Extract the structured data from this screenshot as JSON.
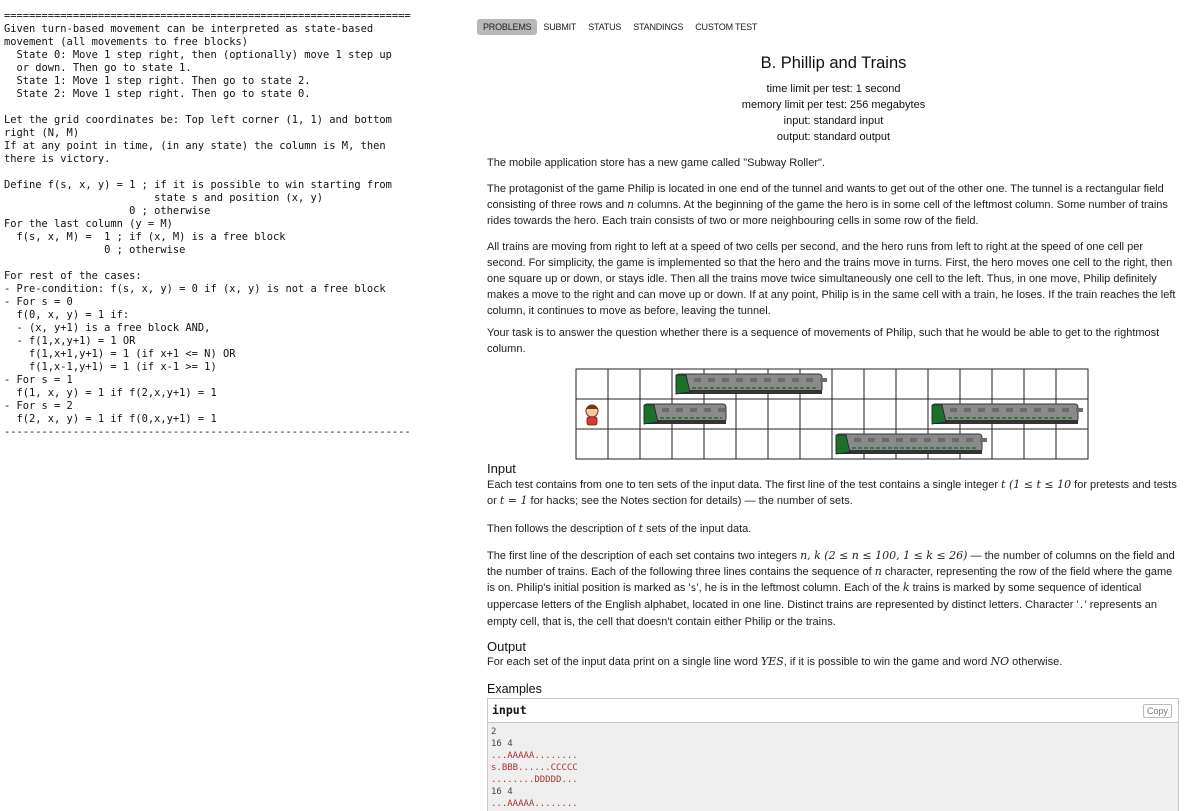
{
  "notes": {
    "text": "=================================================================\nGiven turn-based movement can be interpreted as state-based\nmovement (all movements to free blocks)\n  State 0: Move 1 step right, then (optionally) move 1 step up\n  or down. Then go to state 1.\n  State 1: Move 1 step right. Then go to state 2.\n  State 2: Move 1 step right. Then go to state 0.\n\nLet the grid coordinates be: Top left corner (1, 1) and bottom\nright (N, M)\nIf at any point in time, (in any state) the column is M, then\nthere is victory.\n\nDefine f(s, x, y) = 1 ; if it is possible to win starting from\n                        state s and position (x, y)\n                    0 ; otherwise\nFor the last column (y = M)\n  f(s, x, M) =  1 ; if (x, M) is a free block\n                0 ; otherwise\n\nFor rest of the cases:\n- Pre-condition: f(s, x, y) = 0 if (x, y) is not a free block\n- For s = 0\n  f(0, x, y) = 1 if:\n  - (x, y+1) is a free block AND,\n  - f(1,x,y+1) = 1 OR\n    f(1,x+1,y+1) = 1 (if x+1 <= N) OR\n    f(1,x-1,y+1) = 1 (if x-1 >= 1)\n- For s = 1\n  f(1, x, y) = 1 if f(2,x,y+1) = 1\n- For s = 2\n  f(2, x, y) = 1 if f(0,x,y+1) = 1\n-----------------------------------------------------------------"
  },
  "nav": {
    "problems": "PROBLEMS",
    "submit": "SUBMIT",
    "status": "STATUS",
    "standings": "STANDINGS",
    "custom_test": "CUSTOM TEST"
  },
  "problem": {
    "title": "B. Phillip and Trains",
    "time_limit": "time limit per test: 1 second",
    "memory_limit": "memory limit per test: 256 megabytes",
    "input_file": "input: standard input",
    "output_file": "output: standard output",
    "intro": "The mobile application store has a new game called \"Subway Roller\".",
    "p2_a": "The protagonist of the game Philip is located in one end of the tunnel and wants to get out of the other one. The tunnel is a rectangular field consisting of three rows and ",
    "n": "n",
    "p2_b": " columns. At the beginning of the game the hero is in some cell of the leftmost column. Some number of trains rides towards the hero. Each train consists of two or more neighbouring cells in some row of the field.",
    "p3": "All trains are moving from right to left at a speed of two cells per second, and the hero runs from left to right at the speed of one cell per second. For simplicity, the game is implemented so that the hero and the trains move in turns. First, the hero moves one cell to the right, then one square up or down, or stays idle. Then all the trains move twice simultaneously one cell to the left. Thus, in one move, Philip definitely makes a move to the right and can move up or down. If at any point, Philip is in the same cell with a train, he loses. If the train reaches the left column, it continues to move as before, leaving the tunnel.",
    "p4": "Your task is to answer the question whether there is a sequence of movements of Philip, such that he would be able to get to the rightmost column."
  },
  "input_section": {
    "title": "Input",
    "p1_a": "Each test contains from one to ten sets of the input data. The first line of the test contains a single integer ",
    "p1_math1": "t (1 ≤ t ≤ 10",
    "p1_b": " for pretests and tests or ",
    "p1_math2": "t = 1",
    "p1_c": " for hacks; see the Notes section for details) — the number of sets.",
    "p2_a": "Then follows the description of ",
    "p2_math": "t",
    "p2_b": " sets of the input data.",
    "p3_a": "The first line of the description of each set contains two integers ",
    "p3_math1": "n, k (2 ≤ n ≤ 100, 1 ≤ k ≤ 26)",
    "p3_b": " — the number of columns on the field and the number of trains. Each of the following three lines contains the sequence of ",
    "p3_math2": "n",
    "p3_c": " character, representing the row of the field where the game is on. Philip's initial position is marked as '",
    "p3_s": "s",
    "p3_d": "', he is in the leftmost column. Each of the ",
    "p3_math3": "k",
    "p3_e": " trains is marked by some sequence of identical uppercase letters of the English alphabet, located in one line. Distinct trains are represented by distinct letters. Character '",
    "p3_dot": ".",
    "p3_f": "' represents an empty cell, that is, the cell that doesn't contain either Philip or the trains."
  },
  "output_section": {
    "title": "Output",
    "p1_a": "For each set of the input data print on a single line word ",
    "yes": "YES",
    "p1_b": ", if it is possible to win the game and word ",
    "no": "NO",
    "p1_c": " otherwise."
  },
  "examples": {
    "title": "Examples",
    "input_label": "input",
    "copy_label": "Copy",
    "lines": [
      "2",
      "16 4",
      "...AAAAA........",
      "s.BBB......CCCCC",
      "........DDDDD...",
      "16 4",
      "...AAAAA........"
    ]
  },
  "illustration": {
    "rows": 3,
    "cols": 16,
    "trains": [
      {
        "row": 0,
        "start": 3,
        "end": 7
      },
      {
        "row": 1,
        "start": 2,
        "end": 4
      },
      {
        "row": 1,
        "start": 11,
        "end": 15
      },
      {
        "row": 2,
        "start": 8,
        "end": 12
      }
    ],
    "hero": {
      "row": 1,
      "col": 0
    },
    "train_color": "#8a8a8a",
    "train_accent": "#1f6f2a"
  }
}
